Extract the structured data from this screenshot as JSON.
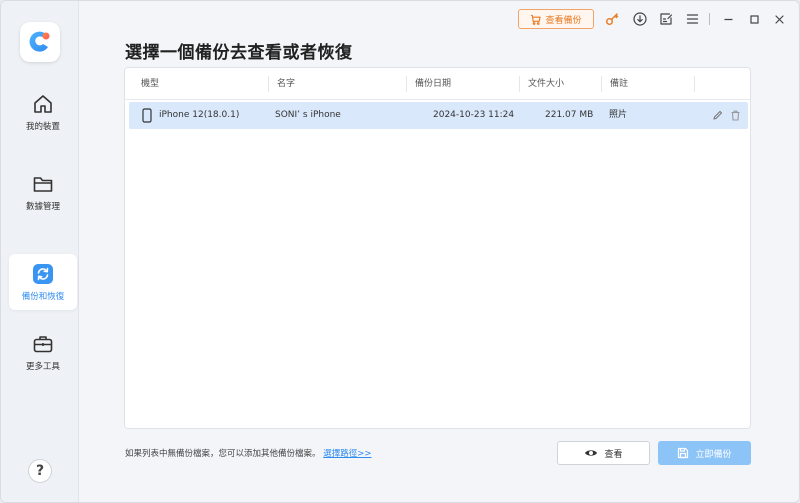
{
  "sidebar": {
    "items": [
      {
        "label": "我的裝置",
        "icon": "home-icon"
      },
      {
        "label": "數據管理",
        "icon": "folder-icon"
      },
      {
        "label": "備份和恢復",
        "icon": "backup-restore-icon",
        "active": true
      },
      {
        "label": "更多工具",
        "icon": "toolbox-icon"
      }
    ],
    "help_label": "?"
  },
  "titlebar": {
    "view_backups_label": "查看備份",
    "icons": [
      "key-icon",
      "download-icon",
      "feedback-icon",
      "menu-icon",
      "minimize-icon",
      "maximize-icon",
      "close-icon"
    ]
  },
  "main": {
    "title": "選擇一個備份去查看或者恢復",
    "table": {
      "columns": [
        "機型",
        "名字",
        "備份日期",
        "文件大小",
        "備註"
      ],
      "rows": [
        {
          "model": "iPhone 12(18.0.1)",
          "name": "SONI’ s iPhone",
          "date": "2024-10-23 11:24",
          "size": "221.07 MB",
          "note": "照片"
        }
      ]
    }
  },
  "footer": {
    "hint_text": "如果列表中無備份檔案，您可以添加其他備份檔案。",
    "hint_link": "選擇路徑>>",
    "view_button": "查看",
    "backup_button": "立即備份"
  },
  "colors": {
    "accent": "#2e8cf0",
    "backup_button_bg": "#8cc4f8",
    "orange": "#e8781f",
    "row_selected": "#d9e9fb"
  }
}
